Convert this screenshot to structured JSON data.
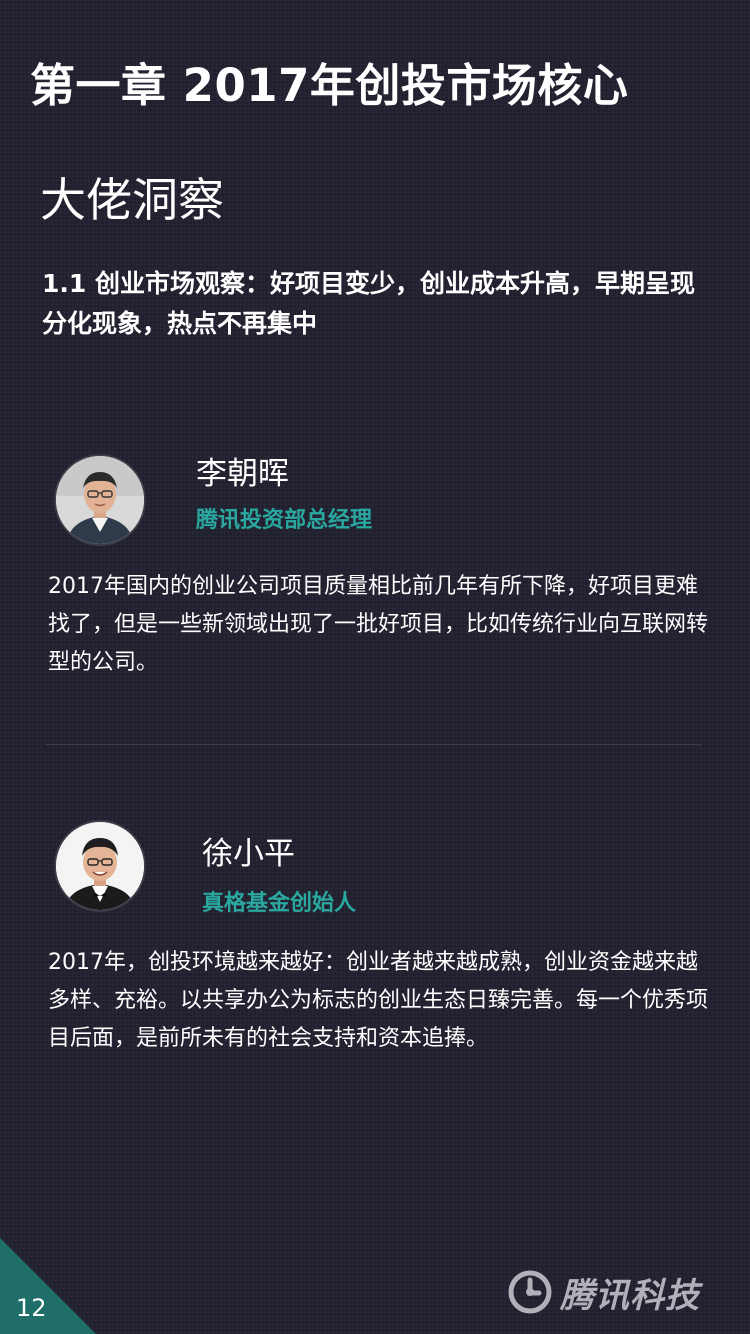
{
  "header": {
    "chapter_title": "第一章 2017年创投市场核心",
    "section_title": "大佬洞察",
    "subtitle": "1.1 创业市场观察：好项目变少，创业成本升高，早期呈现分化现象，热点不再集中"
  },
  "experts": [
    {
      "name": "李朝晖",
      "role": "腾讯投资部总经理",
      "quote": "2017年国内的创业公司项目质量相比前几年有所下降，好项目更难找了，但是一些新领域出现了一批好项目，比如传统行业向互联网转型的公司。"
    },
    {
      "name": "徐小平",
      "role": "真格基金创始人",
      "quote": "2017年，创投环境越来越好：创业者越来越成熟，创业资金越来越多样、充裕。以共享办公为标志的创业生态日臻完善。每一个优秀项目后面，是前所未有的社会支持和资本追捧。"
    }
  ],
  "footer": {
    "page_number": "12",
    "brand_name": "腾讯科技",
    "brand_icon": "tencent-logo-icon"
  },
  "colors": {
    "background": "#20202e",
    "accent_teal": "#2aa8a0",
    "corner": "#1f6e6a",
    "text": "#ffffff"
  }
}
